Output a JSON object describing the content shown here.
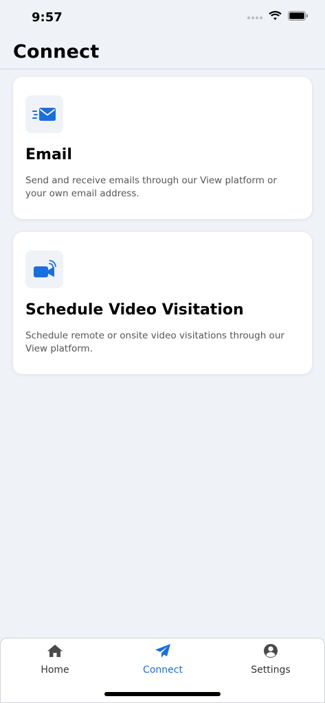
{
  "status_bar": {
    "time": "9:57",
    "icons": [
      "cellular-signal-icon",
      "wifi-icon",
      "battery-icon"
    ]
  },
  "header": {
    "title": "Connect"
  },
  "cards": [
    {
      "title": "Email",
      "description": "Send and receive emails through our View platform or your own email address.",
      "icon": "email-icon"
    },
    {
      "title": "Schedule Video Visitation",
      "description": "Schedule remote or onsite video visitations through our View platform.",
      "icon": "video-camera-icon"
    }
  ],
  "tab_bar": {
    "items": [
      {
        "label": "Home",
        "icon": "home-icon",
        "active": false
      },
      {
        "label": "Connect",
        "icon": "paper-plane-icon",
        "active": true
      },
      {
        "label": "Settings",
        "icon": "account-circle-icon",
        "active": false
      }
    ]
  },
  "colors": {
    "accent": "#1a6fe0",
    "background": "#eff2f7",
    "card": "#ffffff",
    "icon_box": "#eff3f8",
    "inactive_tab": "#4a4a4a"
  }
}
